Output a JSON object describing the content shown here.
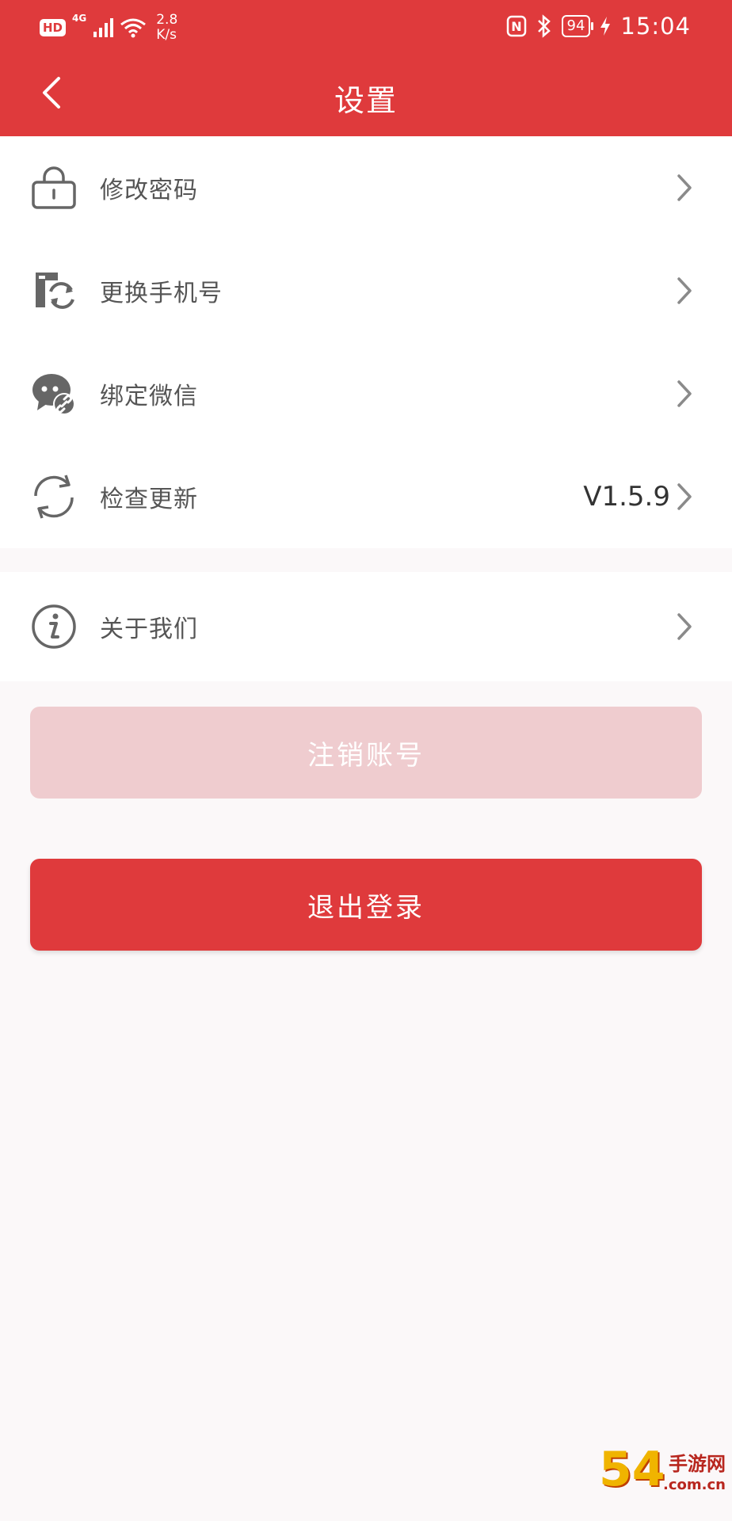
{
  "status_bar": {
    "hd": "HD",
    "network": "4G",
    "speed_value": "2.8",
    "speed_unit": "K/s",
    "nfc": "N",
    "battery": "94",
    "time": "15:04"
  },
  "header": {
    "title": "设置"
  },
  "settings_group_1": [
    {
      "label": "修改密码",
      "icon": "lock-icon"
    },
    {
      "label": "更换手机号",
      "icon": "phone-swap-icon"
    },
    {
      "label": "绑定微信",
      "icon": "wechat-link-icon"
    },
    {
      "label": "检查更新",
      "icon": "refresh-icon",
      "value": "V1.5.9"
    }
  ],
  "settings_group_2": [
    {
      "label": "关于我们",
      "icon": "info-icon"
    }
  ],
  "buttons": {
    "deregister": "注销账号",
    "logout": "退出登录"
  },
  "watermark": {
    "number": "54",
    "brand": "手游网",
    "domain": ".com.cn"
  },
  "colors": {
    "primary": "#df3a3c",
    "disabled_button": "#efcccf",
    "background": "#fbf8f9",
    "icon_gray": "#666666"
  }
}
